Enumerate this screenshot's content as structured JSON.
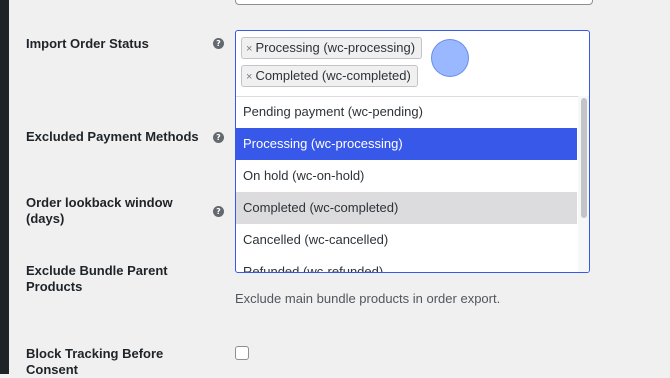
{
  "colors": {
    "accent": "#3858e9",
    "page_bg": "#f0f0f1",
    "left_strip": "#1d2327"
  },
  "help_icon_glyph": "?",
  "fields": {
    "import_order_status": {
      "label": "Import Order Status"
    },
    "excluded_payment_methods": {
      "label": "Excluded Payment Methods"
    },
    "order_lookback_window": {
      "label": "Order lookback window (days)"
    },
    "exclude_bundle_parent": {
      "label": "Exclude Bundle Parent Products",
      "description": "Exclude main bundle products in order export."
    },
    "block_tracking": {
      "label": "Block Tracking Before Consent"
    }
  },
  "status_select": {
    "selected_chips": [
      {
        "remove": "×",
        "label": "Processing (wc-processing)"
      },
      {
        "remove": "×",
        "label": "Completed (wc-completed)"
      }
    ],
    "options": [
      {
        "label": "Pending payment (wc-pending)"
      },
      {
        "label": "Processing (wc-processing)"
      },
      {
        "label": "On hold (wc-on-hold)"
      },
      {
        "label": "Completed (wc-completed)"
      },
      {
        "label": "Cancelled (wc-cancelled)"
      },
      {
        "label": "Refunded (wc-refunded)"
      }
    ]
  }
}
